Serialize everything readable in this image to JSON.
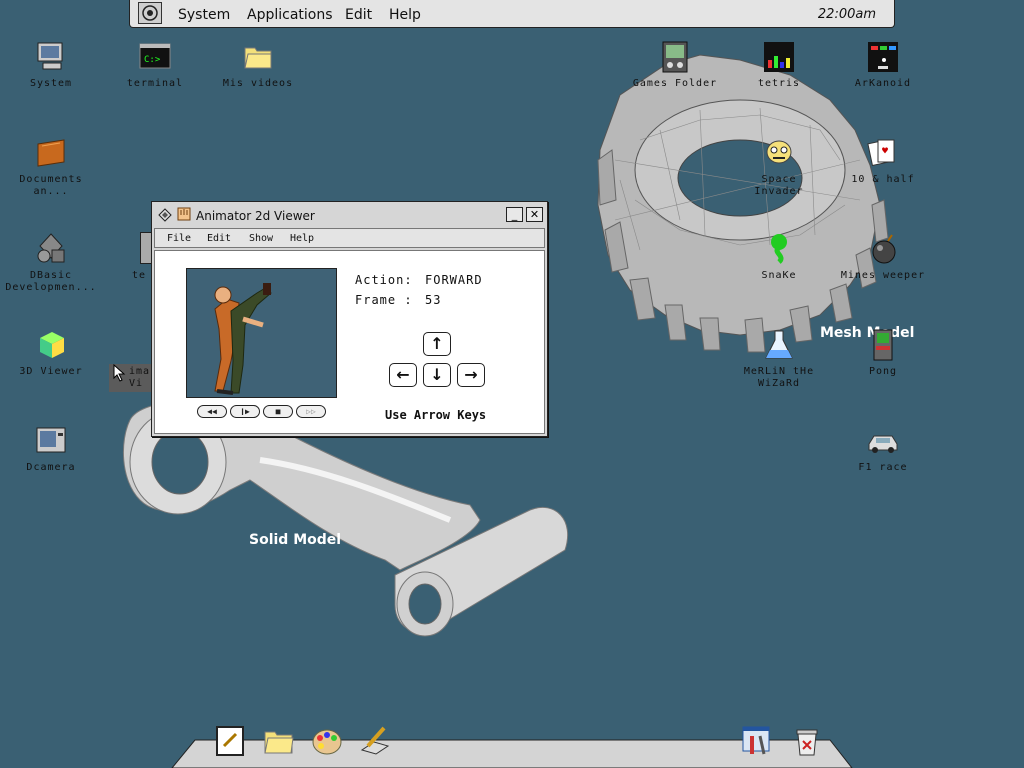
{
  "menubar": {
    "items": [
      {
        "label": "System"
      },
      {
        "label": "Applications"
      },
      {
        "label": "Edit"
      },
      {
        "label": "Help"
      }
    ],
    "clock": "22:00am"
  },
  "desktop_left": [
    {
      "label": "System"
    },
    {
      "label": "terminal"
    },
    {
      "label": "Mis videos"
    },
    {
      "label": "Documents\nan..."
    },
    {
      "label": "DBasic\nDevelopmen..."
    },
    {
      "label": "3D Viewer"
    },
    {
      "label": "Dcamera"
    },
    {
      "label": "te"
    },
    {
      "label": "ima\nVi"
    }
  ],
  "desktop_right": [
    {
      "label": "Games Folder"
    },
    {
      "label": "tetris"
    },
    {
      "label": "ArKanoid"
    },
    {
      "label": "Space\nInvader"
    },
    {
      "label": "10 & half"
    },
    {
      "label": "SnaKe"
    },
    {
      "label": "Mines weeper"
    },
    {
      "label": "MeRLiN tHe\nWiZaRd"
    },
    {
      "label": "Pong"
    },
    {
      "label": "F1 race"
    }
  ],
  "art_labels": {
    "mesh": "Mesh Model",
    "solid": "Solid Model"
  },
  "window": {
    "title": "Animator 2d Viewer",
    "menu": [
      "File",
      "Edit",
      "Show",
      "Help"
    ],
    "action_label": "Action:",
    "action_value": "FORWARD",
    "frame_label": "Frame :",
    "frame_value": "53",
    "hint": "Use Arrow Keys",
    "playback": [
      "rewind",
      "step",
      "stop",
      "forward"
    ]
  },
  "icons": {
    "colors": {
      "desktop": "#3a6073",
      "window": "#d6d6d6",
      "sprite_bg": "#3f6276"
    }
  }
}
